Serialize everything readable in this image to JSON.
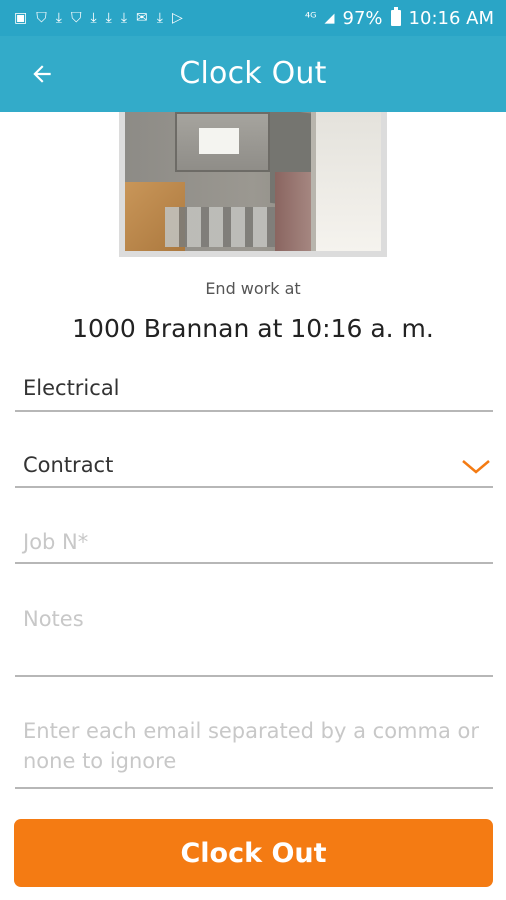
{
  "status_bar": {
    "battery": "97%",
    "time": "10:16 AM",
    "notification_icons": [
      "image-icon",
      "shield-icon",
      "download-icon",
      "shield-icon",
      "download-icon",
      "download-icon",
      "download-icon",
      "mail-icon",
      "download-icon",
      "play-store-icon"
    ]
  },
  "app_bar": {
    "title": "Clock Out",
    "back_icon": "arrow-left-icon"
  },
  "summary": {
    "end_work_label": "End work at",
    "location_time": "1000 Brannan at 10:16 a. m."
  },
  "form": {
    "trade": "Electrical",
    "type": "Contract",
    "type_dropdown_icon": "chevron-down-icon",
    "job_placeholder": "Job N*",
    "notes_placeholder": "Notes",
    "email_placeholder": "Enter each email separated by a comma or none to ignore"
  },
  "actions": {
    "clock_out_label": "Clock Out"
  },
  "colors": {
    "header": "#33abc9",
    "accent": "#f47b13"
  }
}
